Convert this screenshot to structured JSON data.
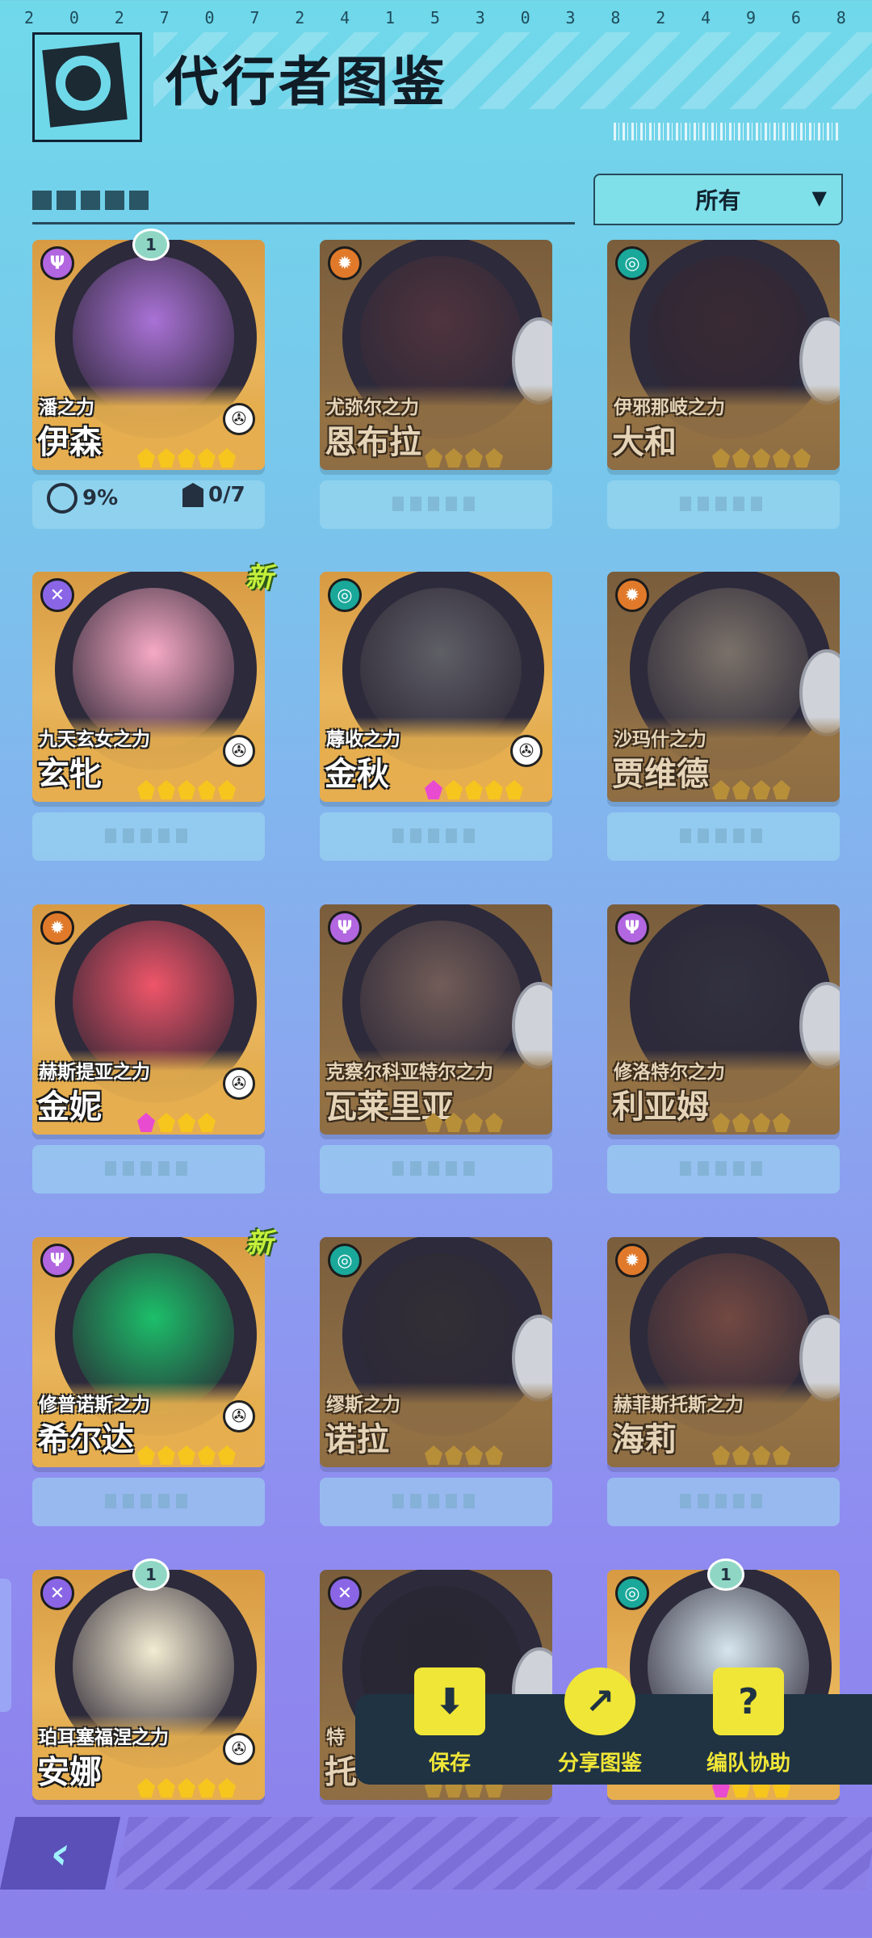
{
  "top_numbers": [
    "2",
    "0",
    "2",
    "7",
    "0",
    "7",
    "2",
    "4",
    "1",
    "5",
    "3",
    "0",
    "3",
    "8",
    "2",
    "4",
    "9",
    "6",
    "8"
  ],
  "header": {
    "title": "代行者图鉴"
  },
  "filter": {
    "label": "所有",
    "arrow": "▼"
  },
  "first_card_stats": {
    "progress": "9%",
    "collect": "0/7"
  },
  "cards": [
    {
      "power": "潘之力",
      "name": "伊森",
      "stars": 5,
      "pink": false,
      "locked": false,
      "elem": "psi",
      "elem_color": "#b266e0",
      "badge": "1",
      "new": false,
      "portrait": "#a972d6"
    },
    {
      "power": "尤弥尔之力",
      "name": "恩布拉",
      "stars": 4,
      "pink": false,
      "locked": true,
      "elem": "sun",
      "elem_color": "#e07a2a",
      "badge": "",
      "new": false,
      "portrait": "#7a4040"
    },
    {
      "power": "伊邪那岐之力",
      "name": "大和",
      "stars": 5,
      "pink": false,
      "locked": true,
      "elem": "swirl",
      "elem_color": "#1aa89a",
      "badge": "",
      "new": false,
      "portrait": "#4a2a2a"
    },
    {
      "power": "九天玄女之力",
      "name": "玄牝",
      "stars": 5,
      "pink": false,
      "locked": false,
      "elem": "cross",
      "elem_color": "#8a66e6",
      "badge": "",
      "new": true,
      "portrait": "#f6a9c4"
    },
    {
      "power": "蓐收之力",
      "name": "金秋",
      "stars": 5,
      "pink": true,
      "locked": false,
      "elem": "swirl",
      "elem_color": "#1aa89a",
      "badge": "",
      "new": false,
      "portrait": "#5f5f66"
    },
    {
      "power": "沙玛什之力",
      "name": "贾维德",
      "stars": 4,
      "pink": false,
      "locked": true,
      "elem": "sun",
      "elem_color": "#e07a2a",
      "badge": "",
      "new": false,
      "portrait": "#d9c8a0"
    },
    {
      "power": "赫斯提亚之力",
      "name": "金妮",
      "stars": 4,
      "pink": true,
      "locked": false,
      "elem": "sun",
      "elem_color": "#e07a2a",
      "badge": "",
      "new": false,
      "portrait": "#ef5569"
    },
    {
      "power": "克察尔科亚特尔之力",
      "name": "瓦莱里亚",
      "stars": 4,
      "pink": false,
      "locked": true,
      "elem": "psi",
      "elem_color": "#b266e0",
      "badge": "",
      "new": false,
      "portrait": "#c79a7a"
    },
    {
      "power": "修洛特尔之力",
      "name": "利亚姆",
      "stars": 4,
      "pink": false,
      "locked": true,
      "elem": "psi",
      "elem_color": "#b266e0",
      "badge": "",
      "new": false,
      "portrait": "#3a3a45"
    },
    {
      "power": "修普诺斯之力",
      "name": "希尔达",
      "stars": 5,
      "pink": false,
      "locked": false,
      "elem": "psi",
      "elem_color": "#b266e0",
      "badge": "",
      "new": true,
      "portrait": "#1cbf6a"
    },
    {
      "power": "缪斯之力",
      "name": "诺拉",
      "stars": 4,
      "pink": false,
      "locked": true,
      "elem": "swirl",
      "elem_color": "#1aa89a",
      "badge": "",
      "new": false,
      "portrait": "#3a3530"
    },
    {
      "power": "赫菲斯托斯之力",
      "name": "海莉",
      "stars": 4,
      "pink": false,
      "locked": true,
      "elem": "sun",
      "elem_color": "#e07a2a",
      "badge": "",
      "new": false,
      "portrait": "#c96e4a"
    },
    {
      "power": "珀耳塞福涅之力",
      "name": "安娜",
      "stars": 5,
      "pink": false,
      "locked": false,
      "elem": "cross",
      "elem_color": "#8a66e6",
      "badge": "1",
      "new": false,
      "portrait": "#f3ecd2"
    },
    {
      "power": "特",
      "name": "托",
      "stars": 4,
      "pink": false,
      "locked": true,
      "elem": "cross",
      "elem_color": "#8a66e6",
      "badge": "",
      "new": false,
      "portrait": "#222"
    },
    {
      "power": "",
      "name": "",
      "stars": 4,
      "pink": true,
      "locked": false,
      "elem": "swirl",
      "elem_color": "#1aa89a",
      "badge": "1",
      "new": false,
      "portrait": "#d6e6ee"
    }
  ],
  "actions": {
    "save": "保存",
    "share": "分享图鉴",
    "team": "编队协助"
  },
  "back_symbol": "‹",
  "new_tag": "新"
}
